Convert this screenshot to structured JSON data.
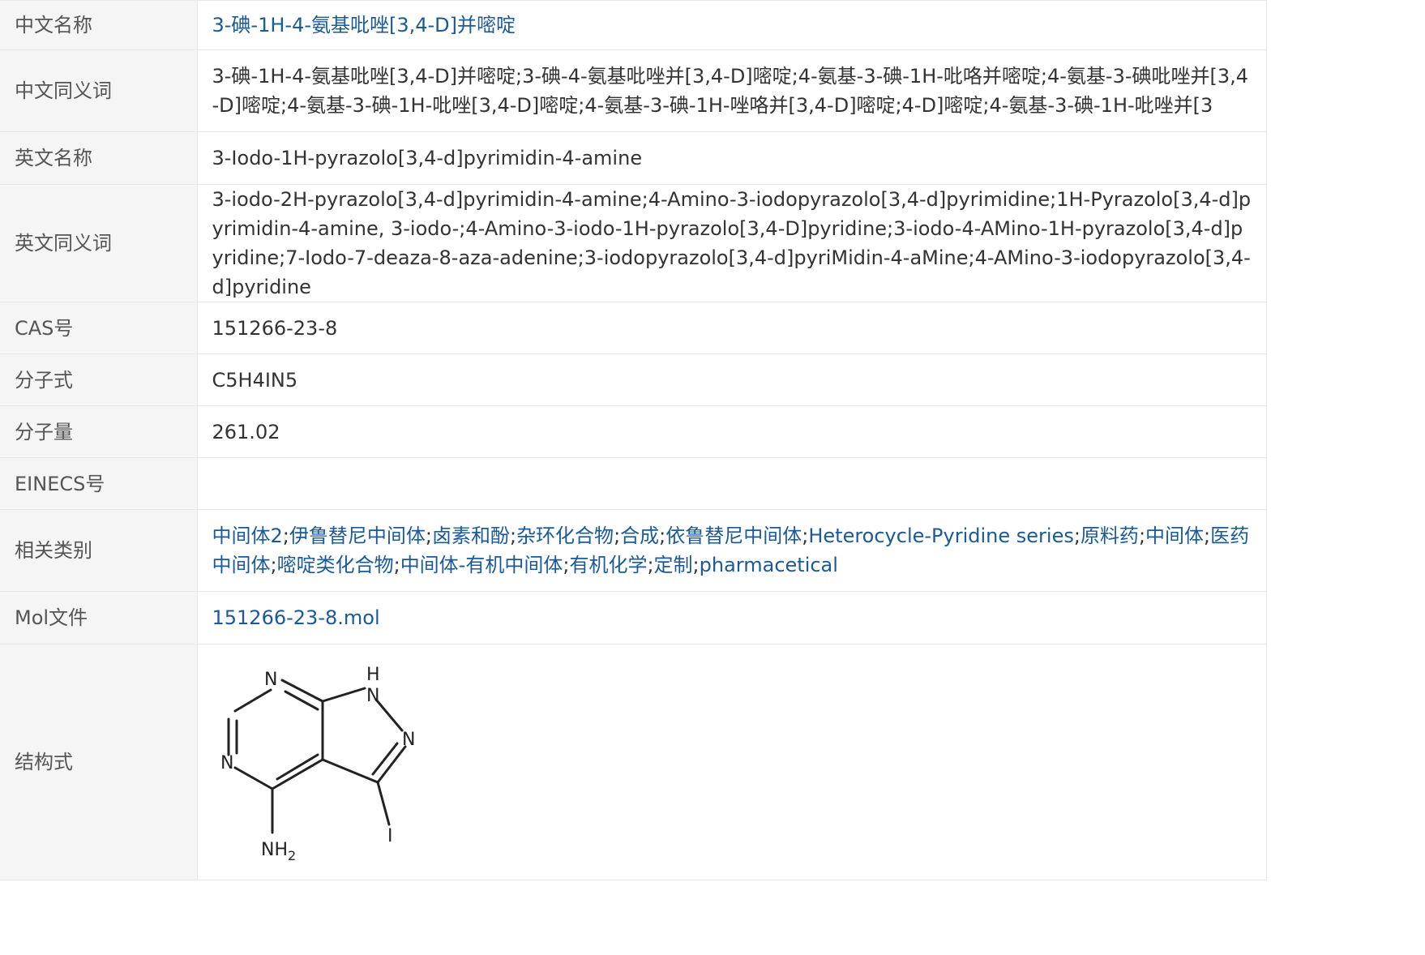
{
  "rows": {
    "cn_name": {
      "label": "中文名称",
      "value": "3-碘-1H-4-氨基吡唑[3,4-D]并嘧啶"
    },
    "cn_synonyms": {
      "label": "中文同义词",
      "value": "3-碘-1H-4-氨基吡唑[3,4-D]并嘧啶;3-碘-4-氨基吡唑并[3,4-D]嘧啶;4-氨基-3-碘-1H-吡咯并嘧啶;4-氨基-3-碘吡唑并[3,4-D]嘧啶;4-氨基-3-碘-1H-吡唑[3,4-D]嘧啶;4-氨基-3-碘-1H-唑咯并[3,4-D]嘧啶;4-D]嘧啶;4-氨基-3-碘-1H-吡唑并[3"
    },
    "en_name": {
      "label": "英文名称",
      "value": "3-Iodo-1H-pyrazolo[3,4-d]pyrimidin-4-amine"
    },
    "en_synonyms": {
      "label": "英文同义词",
      "value": "3-iodo-2H-pyrazolo[3,4-d]pyrimidin-4-amine;4-Amino-3-iodopyrazolo[3,4-d]pyrimidine;1H-Pyrazolo[3,4-d]pyrimidin-4-amine, 3-iodo-;4-Amino-3-iodo-1H-pyrazolo[3,4-D]pyridine;3-iodo-4-AMino-1H-pyrazolo[3,4-d]pyridine;7-Iodo-7-deaza-8-aza-adenine;3-iodopyrazolo[3,4-d]pyriMidin-4-aMine;4-AMino-3-iodopyrazolo[3,4-d]pyridine"
    },
    "cas": {
      "label": "CAS号",
      "value": "151266-23-8"
    },
    "formula": {
      "label": "分子式",
      "value": "C5H4IN5"
    },
    "mw": {
      "label": "分子量",
      "value": "261.02"
    },
    "einecs": {
      "label": "EINECS号",
      "value": ""
    },
    "categories": {
      "label": "相关类别",
      "items": [
        "中间体2",
        "伊鲁替尼中间体",
        "卤素和酚",
        "杂环化合物",
        "合成",
        "依鲁替尼中间体",
        "Heterocycle-Pyridine series",
        "原料药",
        "中间体",
        "医药中间体",
        "嘧啶类化合物",
        "中间体-有机中间体",
        "有机化学",
        "定制",
        "pharmacetical"
      ],
      "separator": ";"
    },
    "mol": {
      "label": "Mol文件",
      "value": "151266-23-8.mol"
    },
    "structure": {
      "label": "结构式",
      "atoms": {
        "n_top": "N",
        "h_top": "H",
        "n_nh": "N",
        "n_right": "N",
        "n_left": "N",
        "iodine": "I",
        "nh2_main": "NH",
        "nh2_sub": "2"
      }
    }
  },
  "colors": {
    "link": "#1a5a9a",
    "label_bg": "#f5f5f5",
    "border": "#e6e6e6",
    "text": "#333333"
  }
}
